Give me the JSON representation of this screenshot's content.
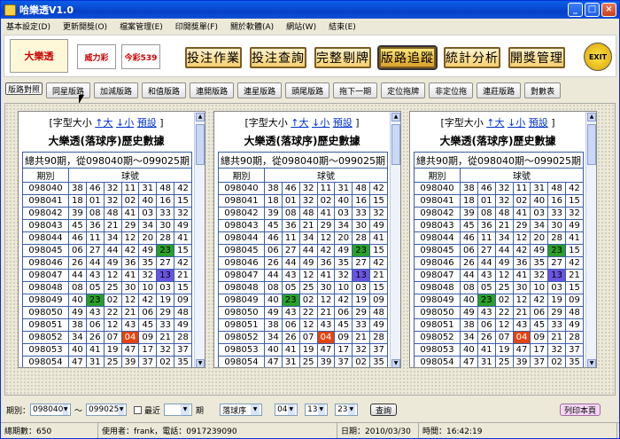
{
  "window": {
    "title": "哈樂透V1.0"
  },
  "menu": [
    "基本設定(D)",
    "更新開獎(O)",
    "檔案管理(E)",
    "印開獎單(F)",
    "關於軟體(A)",
    "網站(W)",
    "結束(E)"
  ],
  "logos": {
    "l1": "大樂透",
    "l2": "威力彩",
    "l3": "今彩539"
  },
  "bigbuttons": [
    "投注作業",
    "投注查詢",
    "完整剔牌",
    "版路追蹤",
    "統計分析",
    "開獎管理"
  ],
  "exit": "EXIT",
  "tabs": [
    "版路對照",
    "同星版路",
    "加減版路",
    "和值版路",
    "連開版路",
    "連星版路",
    "頭尾版路",
    "拖下一期",
    "定位拖牌",
    "非定位拖",
    "連莊版路",
    "對數表"
  ],
  "panel": {
    "font_line": "[字型大小",
    "plus": "↑大",
    "minus": "↓小",
    "preset": "預設",
    "close": "]",
    "title": "大樂透(落球序)歷史數據",
    "range": "總共90期，從098040期～099025期",
    "h_period": "期別",
    "h_balls": "球號"
  },
  "rows": [
    {
      "p": "098040",
      "n": [
        "38",
        "46",
        "32",
        "11",
        "31",
        "48",
        "42"
      ]
    },
    {
      "p": "098041",
      "n": [
        "18",
        "01",
        "32",
        "02",
        "40",
        "16",
        "15"
      ]
    },
    {
      "p": "098042",
      "n": [
        "39",
        "08",
        "48",
        "41",
        "03",
        "33",
        "32"
      ]
    },
    {
      "p": "098043",
      "n": [
        "45",
        "36",
        "21",
        "29",
        "34",
        "30",
        "49"
      ]
    },
    {
      "p": "098044",
      "n": [
        "46",
        "11",
        "34",
        "12",
        "20",
        "28",
        "41"
      ]
    },
    {
      "p": "098045",
      "n": [
        "06",
        "27",
        "44",
        "42",
        "49",
        "23",
        "15"
      ]
    },
    {
      "p": "098046",
      "n": [
        "26",
        "44",
        "49",
        "36",
        "35",
        "27",
        "42"
      ]
    },
    {
      "p": "098047",
      "n": [
        "44",
        "43",
        "12",
        "41",
        "32",
        "13",
        "21"
      ]
    },
    {
      "p": "098048",
      "n": [
        "08",
        "05",
        "25",
        "30",
        "10",
        "03",
        "15"
      ]
    },
    {
      "p": "098049",
      "n": [
        "40",
        "23",
        "02",
        "12",
        "42",
        "19",
        "09"
      ]
    },
    {
      "p": "098050",
      "n": [
        "49",
        "43",
        "22",
        "21",
        "06",
        "29",
        "48"
      ]
    },
    {
      "p": "098051",
      "n": [
        "38",
        "06",
        "12",
        "43",
        "45",
        "33",
        "49"
      ]
    },
    {
      "p": "098052",
      "n": [
        "34",
        "26",
        "07",
        "04",
        "09",
        "21",
        "28"
      ]
    },
    {
      "p": "098053",
      "n": [
        "40",
        "41",
        "19",
        "47",
        "17",
        "32",
        "37"
      ]
    },
    {
      "p": "098054",
      "n": [
        "47",
        "31",
        "25",
        "39",
        "37",
        "02",
        "35"
      ]
    }
  ],
  "highlights": {
    "098045-5": "g",
    "098047-5": "b",
    "098049-1": "g",
    "098052-3": "o"
  },
  "bottom": {
    "period_label": "期別：",
    "from": "098040",
    "tilde": "～",
    "to": "099025",
    "recent_label": "最近",
    "recent_value": "",
    "unit": "期",
    "order": "落球序",
    "s1": "04",
    "s2": "13",
    "s3": "23",
    "query": "查詢",
    "print": "列印本頁"
  },
  "status": {
    "total": "總期數：650",
    "user": "使用者：frank，電話：0917239090",
    "date": "日期：2010/03/30",
    "time": "時間：16:42:19"
  }
}
